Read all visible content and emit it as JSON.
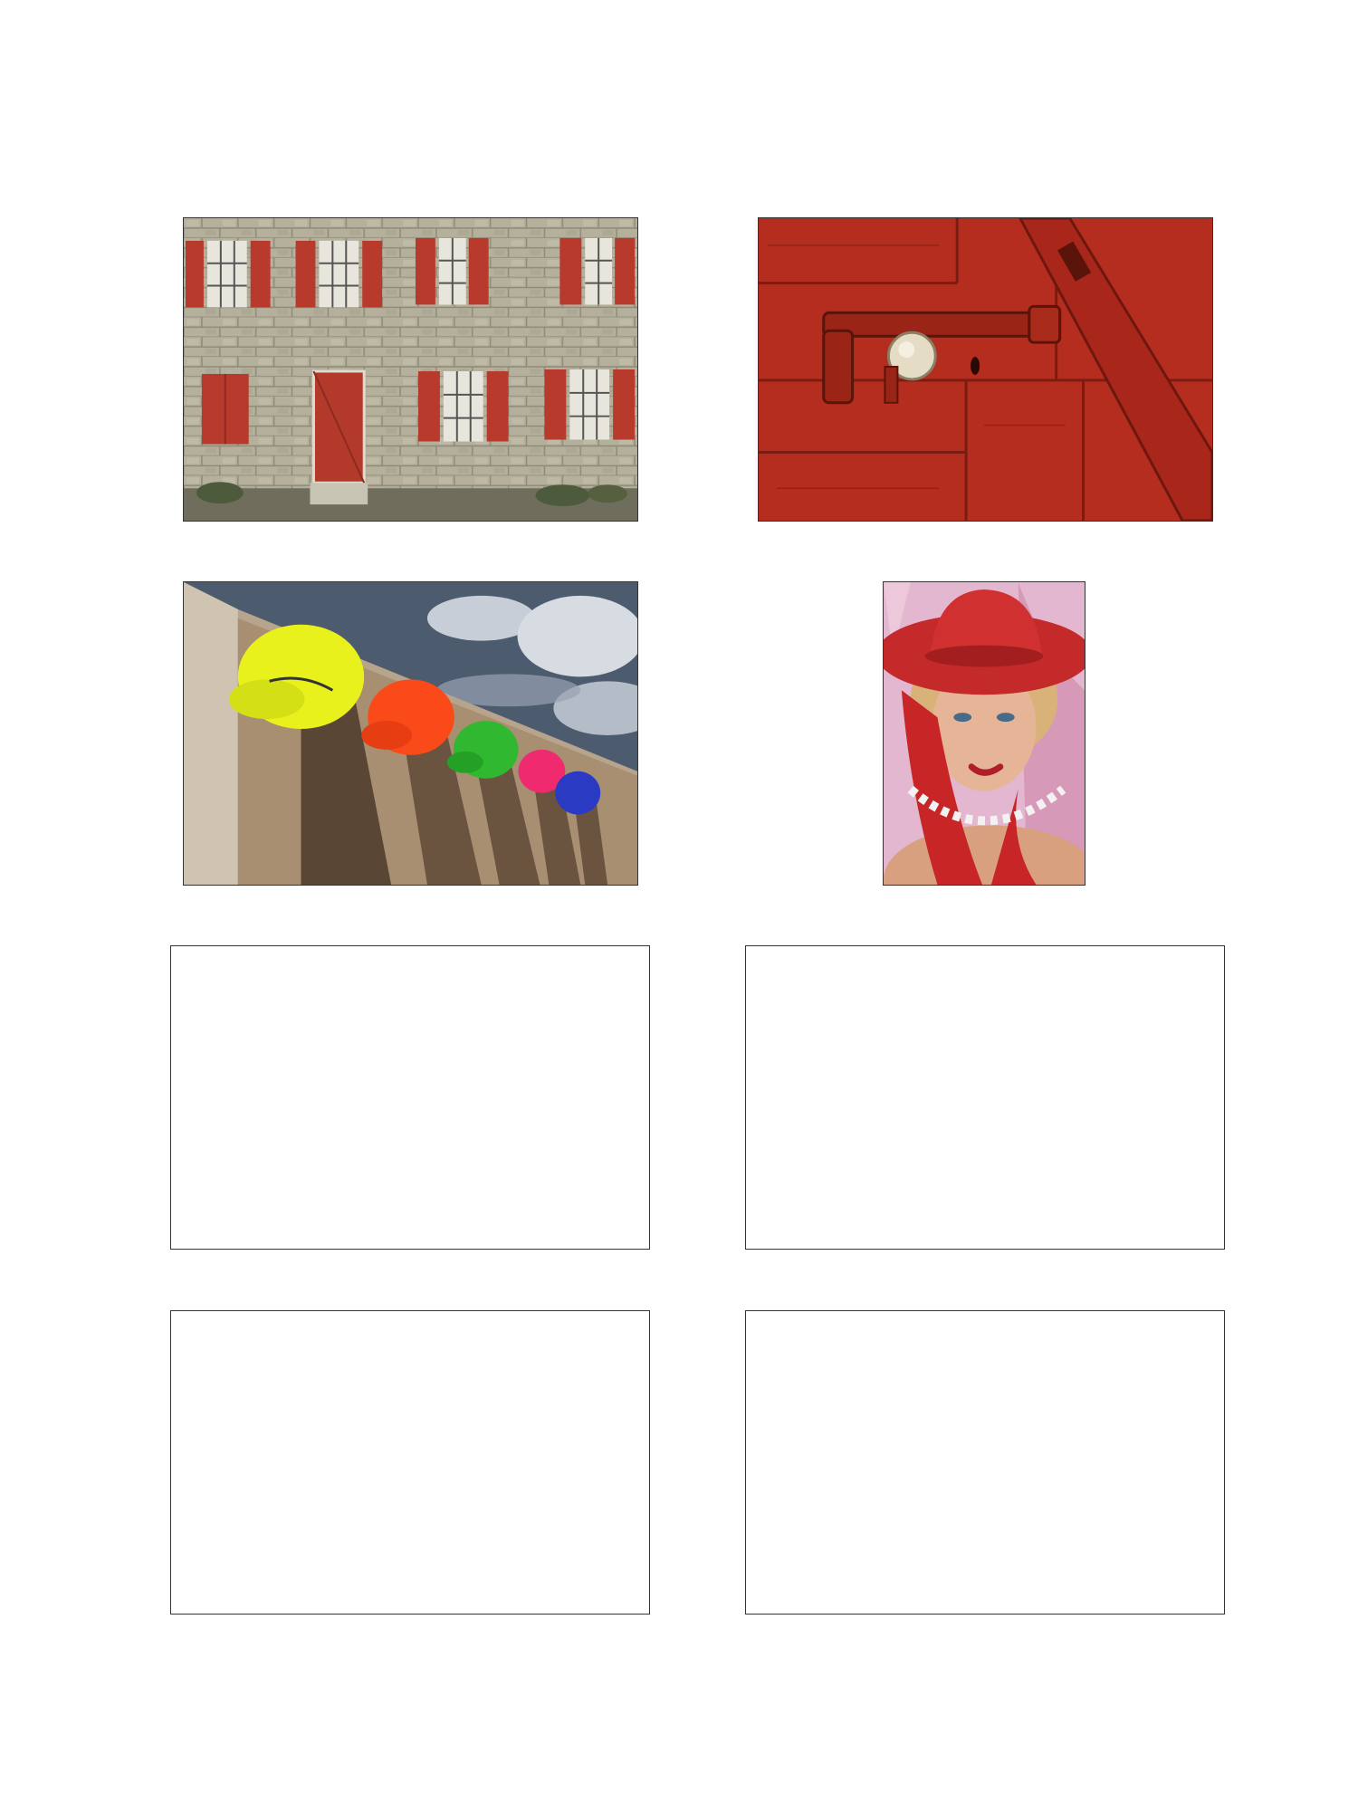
{
  "page": {
    "background": "#ffffff",
    "border_color": "#333333"
  },
  "photos": [
    {
      "id": "house",
      "icon": "stone-house-photo",
      "accent": "#b83a2c"
    },
    {
      "id": "door",
      "icon": "red-door-latch-photo",
      "accent": "#b52d1e"
    },
    {
      "id": "caps",
      "icon": "colored-caps-photo",
      "accent": "#e8f11c"
    },
    {
      "id": "portrait",
      "icon": "woman-red-hat-photo",
      "accent": "#c42a2a"
    }
  ],
  "empty_boxes": [
    {
      "id": "box-1"
    },
    {
      "id": "box-2"
    },
    {
      "id": "box-3"
    },
    {
      "id": "box-4"
    }
  ]
}
